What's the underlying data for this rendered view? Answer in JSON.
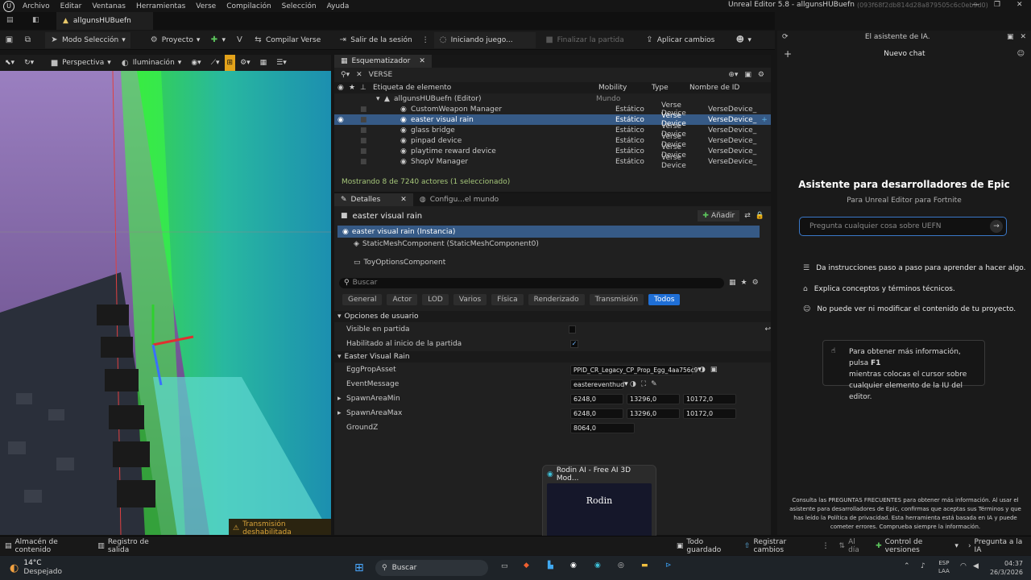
{
  "menu": {
    "items": [
      "Archivo",
      "Editar",
      "Ventanas",
      "Herramientas",
      "Verse",
      "Compilación",
      "Selección",
      "Ayuda"
    ],
    "window_title": "Unreal Editor 5.8 - allgunsHUBuefn",
    "project_id": "(093f68f2db814d28a879505c6c0eb9d0)"
  },
  "doc_tab": {
    "label": "allgunsHUBuefn"
  },
  "toolbar": {
    "mode": "Modo Selección",
    "project": "Proyecto",
    "compile": "Compilar Verse",
    "exit_session": "Salir de la sesión",
    "starting": "Iniciando juego...",
    "end_match": "Finalizar la partida",
    "apply": "Aplicar cambios"
  },
  "viewport": {
    "perspective": "Perspectiva",
    "lighting": "Iluminación",
    "warning": "Transmisión deshabilitada"
  },
  "outliner": {
    "tab": "Esquematizador",
    "filter": "VERSE",
    "cols": {
      "label": "Etiqueta de elemento",
      "mobility": "Mobility",
      "type": "Type",
      "id": "Nombre de ID"
    },
    "root": {
      "name": "allgunsHUBuefn (Editor)",
      "type": "Mundo"
    },
    "rows": [
      {
        "name": "CustomWeapon Manager",
        "mobility": "Estático",
        "type": "Verse Device",
        "id": "VerseDevice_"
      },
      {
        "name": "easter visual rain",
        "mobility": "Estático",
        "type": "Verse Device",
        "id": "VerseDevice_"
      },
      {
        "name": "glass bridge",
        "mobility": "Estático",
        "type": "Verse Device",
        "id": "VerseDevice_"
      },
      {
        "name": "pinpad device",
        "mobility": "Estático",
        "type": "Verse Device",
        "id": "VerseDevice_"
      },
      {
        "name": "playtime reward device",
        "mobility": "Estático",
        "type": "Verse Device",
        "id": "VerseDevice_"
      },
      {
        "name": "ShopV Manager",
        "mobility": "Estático",
        "type": "Verse Device",
        "id": "VerseDevice_"
      }
    ],
    "footer": "Mostrando 8 de 7240 actores (1 seleccionado)"
  },
  "details": {
    "tab1": "Detalles",
    "tab2": "Configu...el mundo",
    "object": "easter visual rain",
    "add": "Añadir",
    "instance": "easter visual rain (Instancia)",
    "component1": "StaticMeshComponent (StaticMeshComponent0)",
    "component2": "ToyOptionsComponent",
    "search_placeholder": "Buscar",
    "categories": [
      "General",
      "Actor",
      "LOD",
      "Varios",
      "Física",
      "Renderizado",
      "Transmisión",
      "Todos"
    ],
    "section_user": "Opciones de usuario",
    "visible": "Visible en partida",
    "enabled": "Habilitado al inicio de la partida",
    "section_easter": "Easter Visual Rain",
    "props": {
      "egg_label": "EggPropAsset",
      "egg_value": "PPID_CR_Legacy_CP_Prop_Egg_4aa756c9",
      "event_label": "EventMessage",
      "event_value": "eastereventhud",
      "min_label": "SpawnAreaMin",
      "min": [
        "6248,0",
        "13296,0",
        "10172,0"
      ],
      "max_label": "SpawnAreaMax",
      "max": [
        "6248,0",
        "13296,0",
        "10172,0"
      ],
      "groundz_label": "GroundZ",
      "groundz": "8064,0"
    }
  },
  "ai": {
    "header": "El asistente de IA.",
    "new_chat": "Nuevo chat",
    "title": "Asistente para desarrolladores de Epic",
    "subtitle": "Para Unreal Editor para Fortnite",
    "input_placeholder": "Pregunta cualquier cosa sobre UEFN",
    "features": [
      "Da instrucciones paso a paso para aprender a hacer algo.",
      "Explica conceptos y términos técnicos.",
      "No puede ver ni modificar el contenido de tu proyecto."
    ],
    "tip1": "Para obtener más información, pulsa",
    "tip_key": "F1",
    "tip2": "mientras colocas el cursor sobre",
    "tip3": "cualquier elemento de la IU del editor.",
    "legal": "Consulta las PREGUNTAS FRECUENTES para obtener más información. Al usar el asistente para desarrolladores de Epic, confirmas que aceptas sus Términos y que has leído la Política de privacidad. Esta herramienta está basada en IA y puede cometer errores. Comprueba siempre la información."
  },
  "status": {
    "content": "Almacén de contenido",
    "log": "Registro de salida",
    "saved": "Todo guardado",
    "register": "Registrar cambios",
    "ai_day": "Al día",
    "version": "Control de versiones",
    "ask_ai": "Pregunta a la IA"
  },
  "popup": {
    "title": "Rodin AI - Free AI 3D Mod...",
    "thumb_text": "Rodin"
  },
  "taskbar": {
    "temp": "14°C",
    "weather": "Despejado",
    "search": "Buscar",
    "lang1": "ESP",
    "lang2": "LAA",
    "time": "04:37",
    "date": "26/3/2026"
  }
}
